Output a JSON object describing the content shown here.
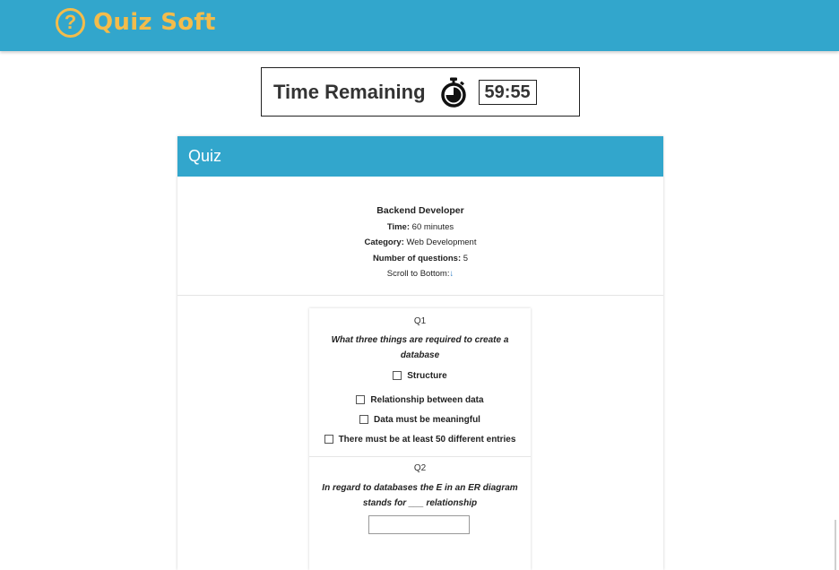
{
  "header": {
    "brand_icon": "?",
    "brand_name": "Quiz Soft",
    "brand_color": "#f3bc4b",
    "bar_color": "#32a6cc"
  },
  "timer": {
    "label": "Time Remaining",
    "icon": "stopwatch-icon",
    "value": "59:55"
  },
  "quiz": {
    "heading": "Quiz",
    "title": "Backend Developer",
    "time_label": "Time:",
    "time_value": "60 minutes",
    "category_label": "Category:",
    "category_value": "Web Development",
    "num_questions_label": "Number of questions:",
    "num_questions_value": "5",
    "scroll_label": "Scroll to Bottom:",
    "scroll_arrow": "↓"
  },
  "questions": [
    {
      "number": "Q1",
      "text": "What three things are required to create a database",
      "options": [
        "Structure",
        "Relationship between data",
        "Data must be meaningful",
        "There must be at least 50 different entries"
      ]
    },
    {
      "number": "Q2",
      "text": "In regard to databases the E in an ER diagram stands for ___ relationship",
      "answer_value": ""
    }
  ]
}
